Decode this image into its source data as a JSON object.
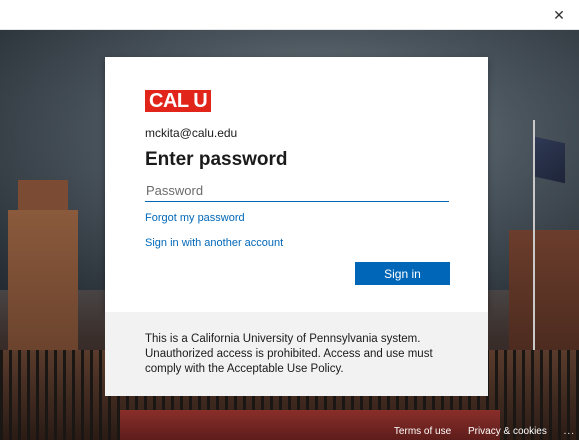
{
  "window": {
    "close_glyph": "✕"
  },
  "signin": {
    "logo_text": "CAL U",
    "email": "mckita@calu.edu",
    "heading": "Enter password",
    "password_placeholder": "Password",
    "password_value": "",
    "forgot_link": "Forgot my password",
    "other_account_link": "Sign in with another account",
    "signin_button": "Sign in"
  },
  "notice": {
    "text": "This is a California University of Pennsylvania system. Unauthorized access is prohibited. Access and use must comply with the Acceptable Use Policy."
  },
  "footer": {
    "terms": "Terms of use",
    "privacy": "Privacy & cookies",
    "more": "..."
  },
  "colors": {
    "accent": "#0067b8",
    "logo_red": "#e1251b",
    "notice_bg": "#f2f2f2"
  }
}
